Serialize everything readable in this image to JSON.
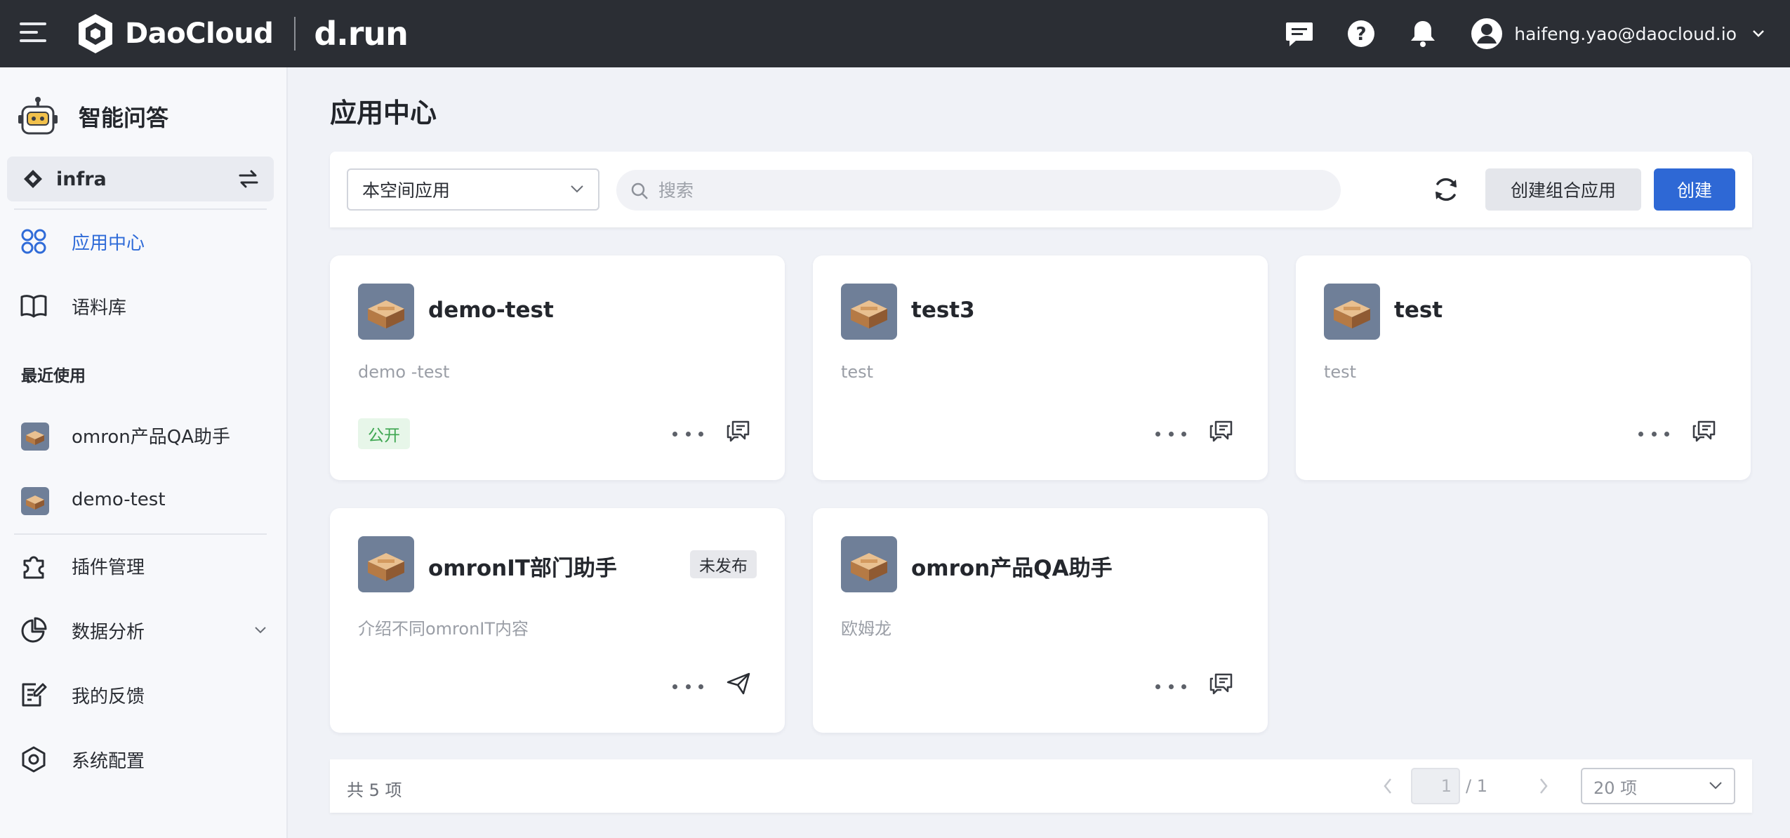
{
  "topbar": {
    "brand": "DaoCloud",
    "product": "d.run",
    "user_email": "haifeng.yao@daocloud.io"
  },
  "sidebar": {
    "app_title": "智能问答",
    "space": "infra",
    "nav": [
      {
        "label": "应用中心",
        "icon": "apps-icon",
        "active": true
      },
      {
        "label": "语料库",
        "icon": "book-icon",
        "active": false
      }
    ],
    "recent_label": "最近使用",
    "recent": [
      {
        "label": "omron产品QA助手"
      },
      {
        "label": "demo-test"
      }
    ],
    "nav2": [
      {
        "label": "插件管理",
        "icon": "plugin-icon"
      },
      {
        "label": "数据分析",
        "icon": "pie-chart-icon"
      },
      {
        "label": "我的反馈",
        "icon": "feedback-icon"
      },
      {
        "label": "系统配置",
        "icon": "gear-icon"
      }
    ]
  },
  "main": {
    "page_title": "应用中心",
    "filter_value": "本空间应用",
    "search_placeholder": "搜索",
    "create_combo_label": "创建组合应用",
    "create_label": "创建",
    "cards": [
      {
        "title": "demo-test",
        "desc": "demo -test",
        "badge": "公开",
        "action_icon": "chat-icon"
      },
      {
        "title": "test3",
        "desc": "test",
        "action_icon": "chat-icon"
      },
      {
        "title": "test",
        "desc": "test",
        "action_icon": "chat-icon"
      },
      {
        "title": "omronIT部门助手",
        "desc": "介绍不同omronIT内容",
        "status": "未发布",
        "action_icon": "send-icon"
      },
      {
        "title": "omron产品QA助手",
        "desc": "欧姆龙",
        "action_icon": "chat-icon"
      }
    ],
    "pagination": {
      "total_text": "共 5 项",
      "current_page": "1",
      "total_pages_text": "/ 1",
      "page_size": "20 项"
    }
  },
  "colors": {
    "topbar_bg": "#2b2e34",
    "accent": "#2e68d5",
    "public_badge_bg": "#e7f6e9",
    "public_badge_text": "#3ea651"
  }
}
